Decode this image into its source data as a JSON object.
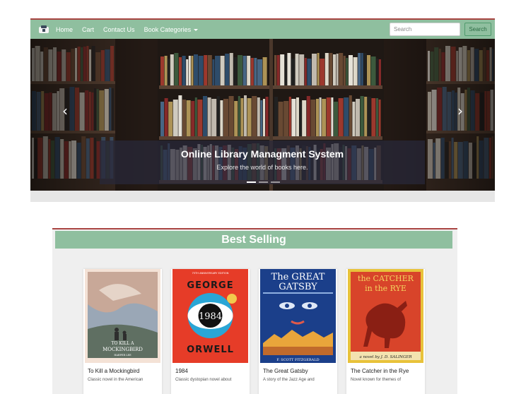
{
  "navbar": {
    "links": [
      "Home",
      "Cart",
      "Contact Us",
      "Book Categories"
    ],
    "search_placeholder": "Search",
    "search_button": "Search"
  },
  "carousel": {
    "title": "Online Library Managment System",
    "subtitle": "Explore the world of books here.",
    "prev": "‹",
    "next": "›",
    "indicator_count": 3,
    "active_indicator": 0
  },
  "best_selling": {
    "heading": "Best Selling",
    "books": [
      {
        "title": "To Kill a Mockingbird",
        "description": "Classic novel in the American",
        "cover": {
          "line1": "TO KILL A",
          "line2": "MOCKINGBIRD",
          "author": "HARPER LEE"
        }
      },
      {
        "title": "1984",
        "description": "Classic dystopian novel about",
        "cover": {
          "edition": "75TH ANNIVERSARY EDITION",
          "top": "GEORGE",
          "number": "1984",
          "bottom": "ORWELL"
        }
      },
      {
        "title": "The Great Gatsby",
        "description": "A story of the Jazz Age and",
        "cover": {
          "line1": "The GREAT",
          "line2": "GATSBY",
          "author": "F. SCOTT FITZGERALD"
        }
      },
      {
        "title": "The Catcher in the Rye",
        "description": "Novel known for themes of",
        "cover": {
          "line1": "the CATCHER",
          "line2": "in the RYE",
          "author": "a novel by J. D. SALINGER"
        }
      }
    ]
  },
  "colors": {
    "nav_green": "#8fbf9f",
    "accent_red": "#a94442",
    "panel_gray": "#efefef"
  }
}
